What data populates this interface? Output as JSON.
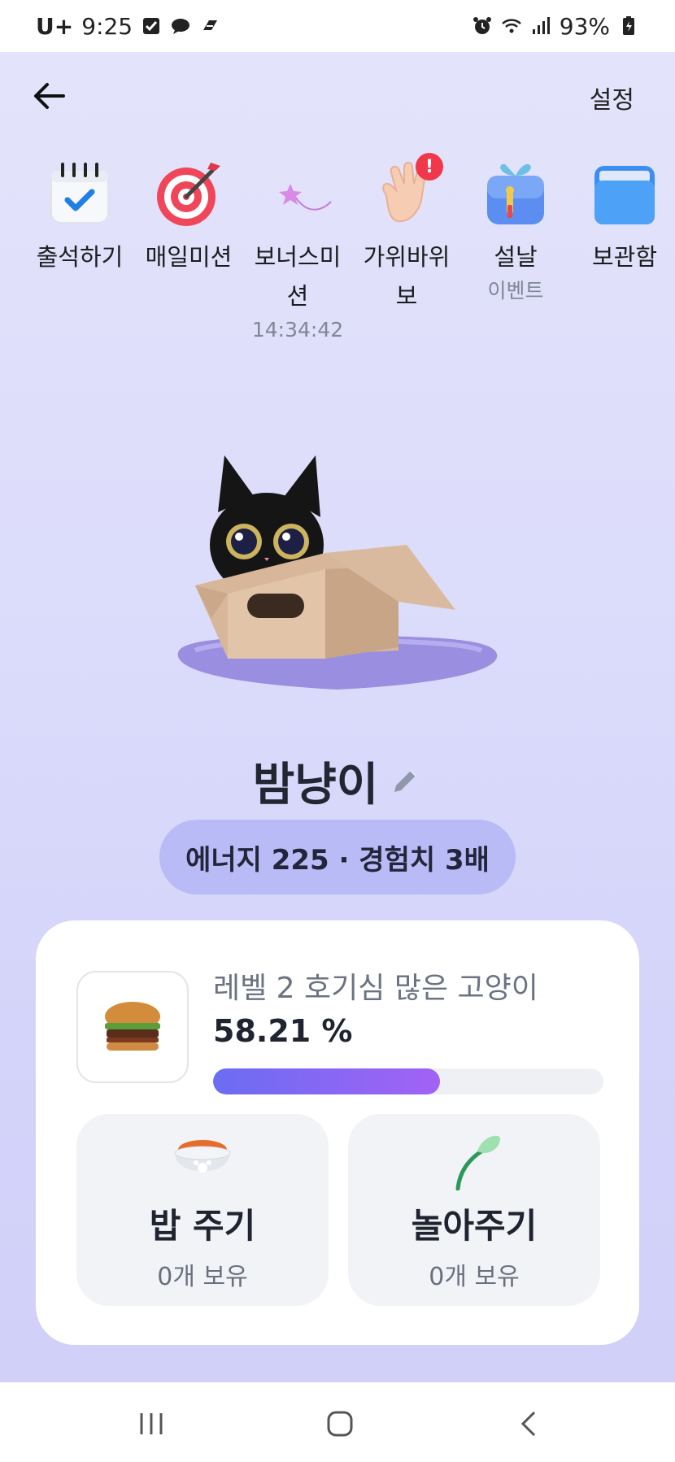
{
  "status_bar": {
    "carrier": "U+",
    "time": "9:25",
    "battery": "93%"
  },
  "header": {
    "settings_label": "설정"
  },
  "menu": {
    "items": [
      {
        "label": "출석하기",
        "sub": "",
        "icon": "calendar-check-icon"
      },
      {
        "label": "매일미션",
        "sub": "",
        "icon": "target-dart-icon"
      },
      {
        "label": "보너스미션",
        "sub": "14:34:42",
        "icon": "shooting-star-icon"
      },
      {
        "label": "가위바위보",
        "sub": "",
        "icon": "hand-wave-icon",
        "badge": "!"
      },
      {
        "label": "설날",
        "sub": "이벤트",
        "icon": "gift-box-icon"
      },
      {
        "label": "보관함",
        "sub": "",
        "icon": "folder-icon"
      }
    ]
  },
  "pet": {
    "name": "밤냥이",
    "stats": "에너지 225 · 경험치 3배"
  },
  "card": {
    "level_text": "레벨 2 호기심 많은 고양이",
    "percent_text": "58.21 %",
    "progress": 0.5821,
    "feed": {
      "title": "밥 주기",
      "sub": "0개 보유"
    },
    "play": {
      "title": "놀아주기",
      "sub": "0개 보유"
    }
  },
  "colors": {
    "accent": "#6b6df2",
    "accent2": "#a262f5",
    "pill": "#b9bbf6",
    "alert": "#f0384a"
  }
}
